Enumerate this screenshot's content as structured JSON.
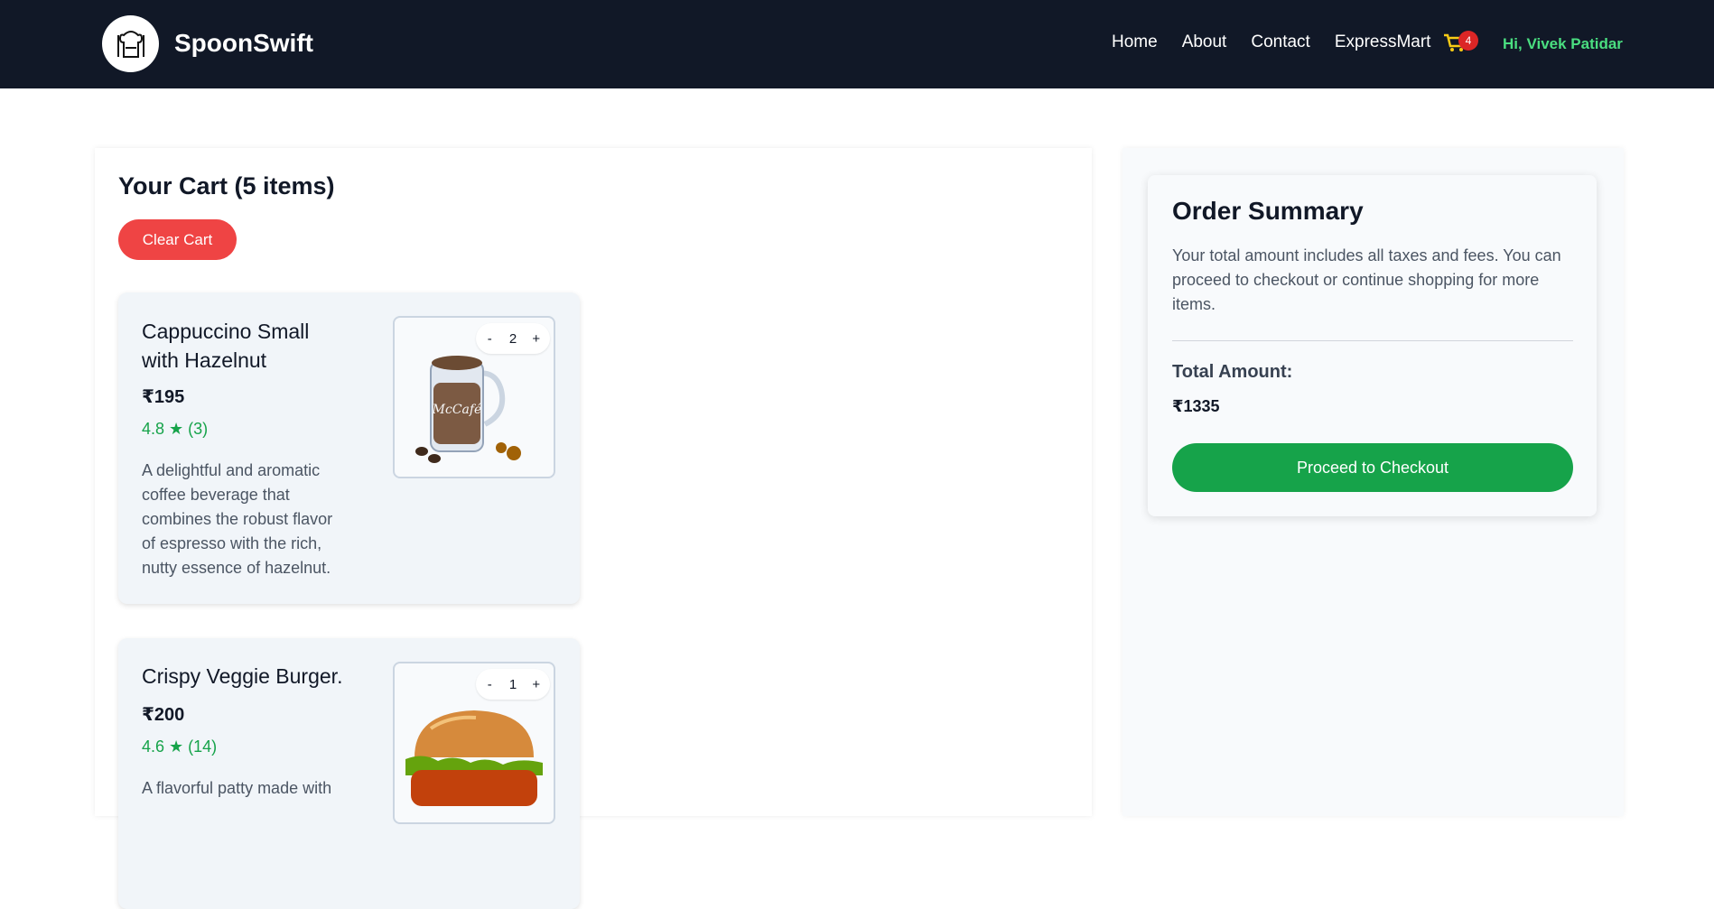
{
  "brand": {
    "name": "SpoonSwift"
  },
  "nav": {
    "links": [
      "Home",
      "About",
      "Contact",
      "ExpressMart"
    ],
    "cart_count": "4",
    "greeting": "Hi, Vivek Patidar"
  },
  "cart": {
    "title": "Your Cart (5 items)",
    "clear_label": "Clear Cart",
    "items": [
      {
        "name": "Cappuccino Small with Hazelnut",
        "price": "₹195",
        "rating": "4.8 ★ (3)",
        "description": "A delightful and aromatic coffee beverage that combines the robust flavor of espresso with the rich, nutty essence of hazelnut.",
        "quantity": "2",
        "image_label": "McCafé"
      },
      {
        "name": "Crispy Veggie Burger.",
        "price": "₹200",
        "rating": "4.6 ★ (14)",
        "description": "A flavorful patty made with",
        "quantity": "1"
      }
    ]
  },
  "summary": {
    "title": "Order Summary",
    "text": "Your total amount includes all taxes and fees. You can proceed to checkout or continue shopping for more items.",
    "total_label": "Total Amount:",
    "total_value": "₹1335",
    "checkout_label": "Proceed to Checkout"
  },
  "qty_controls": {
    "minus": "-",
    "plus": "+"
  },
  "colors": {
    "navbar": "#111827",
    "accent_green": "#16a34a",
    "danger_red": "#ef4444",
    "greeting": "#4ade80"
  },
  "icons": {
    "logo": "chef-logo-icon",
    "cart": "cart-icon"
  }
}
